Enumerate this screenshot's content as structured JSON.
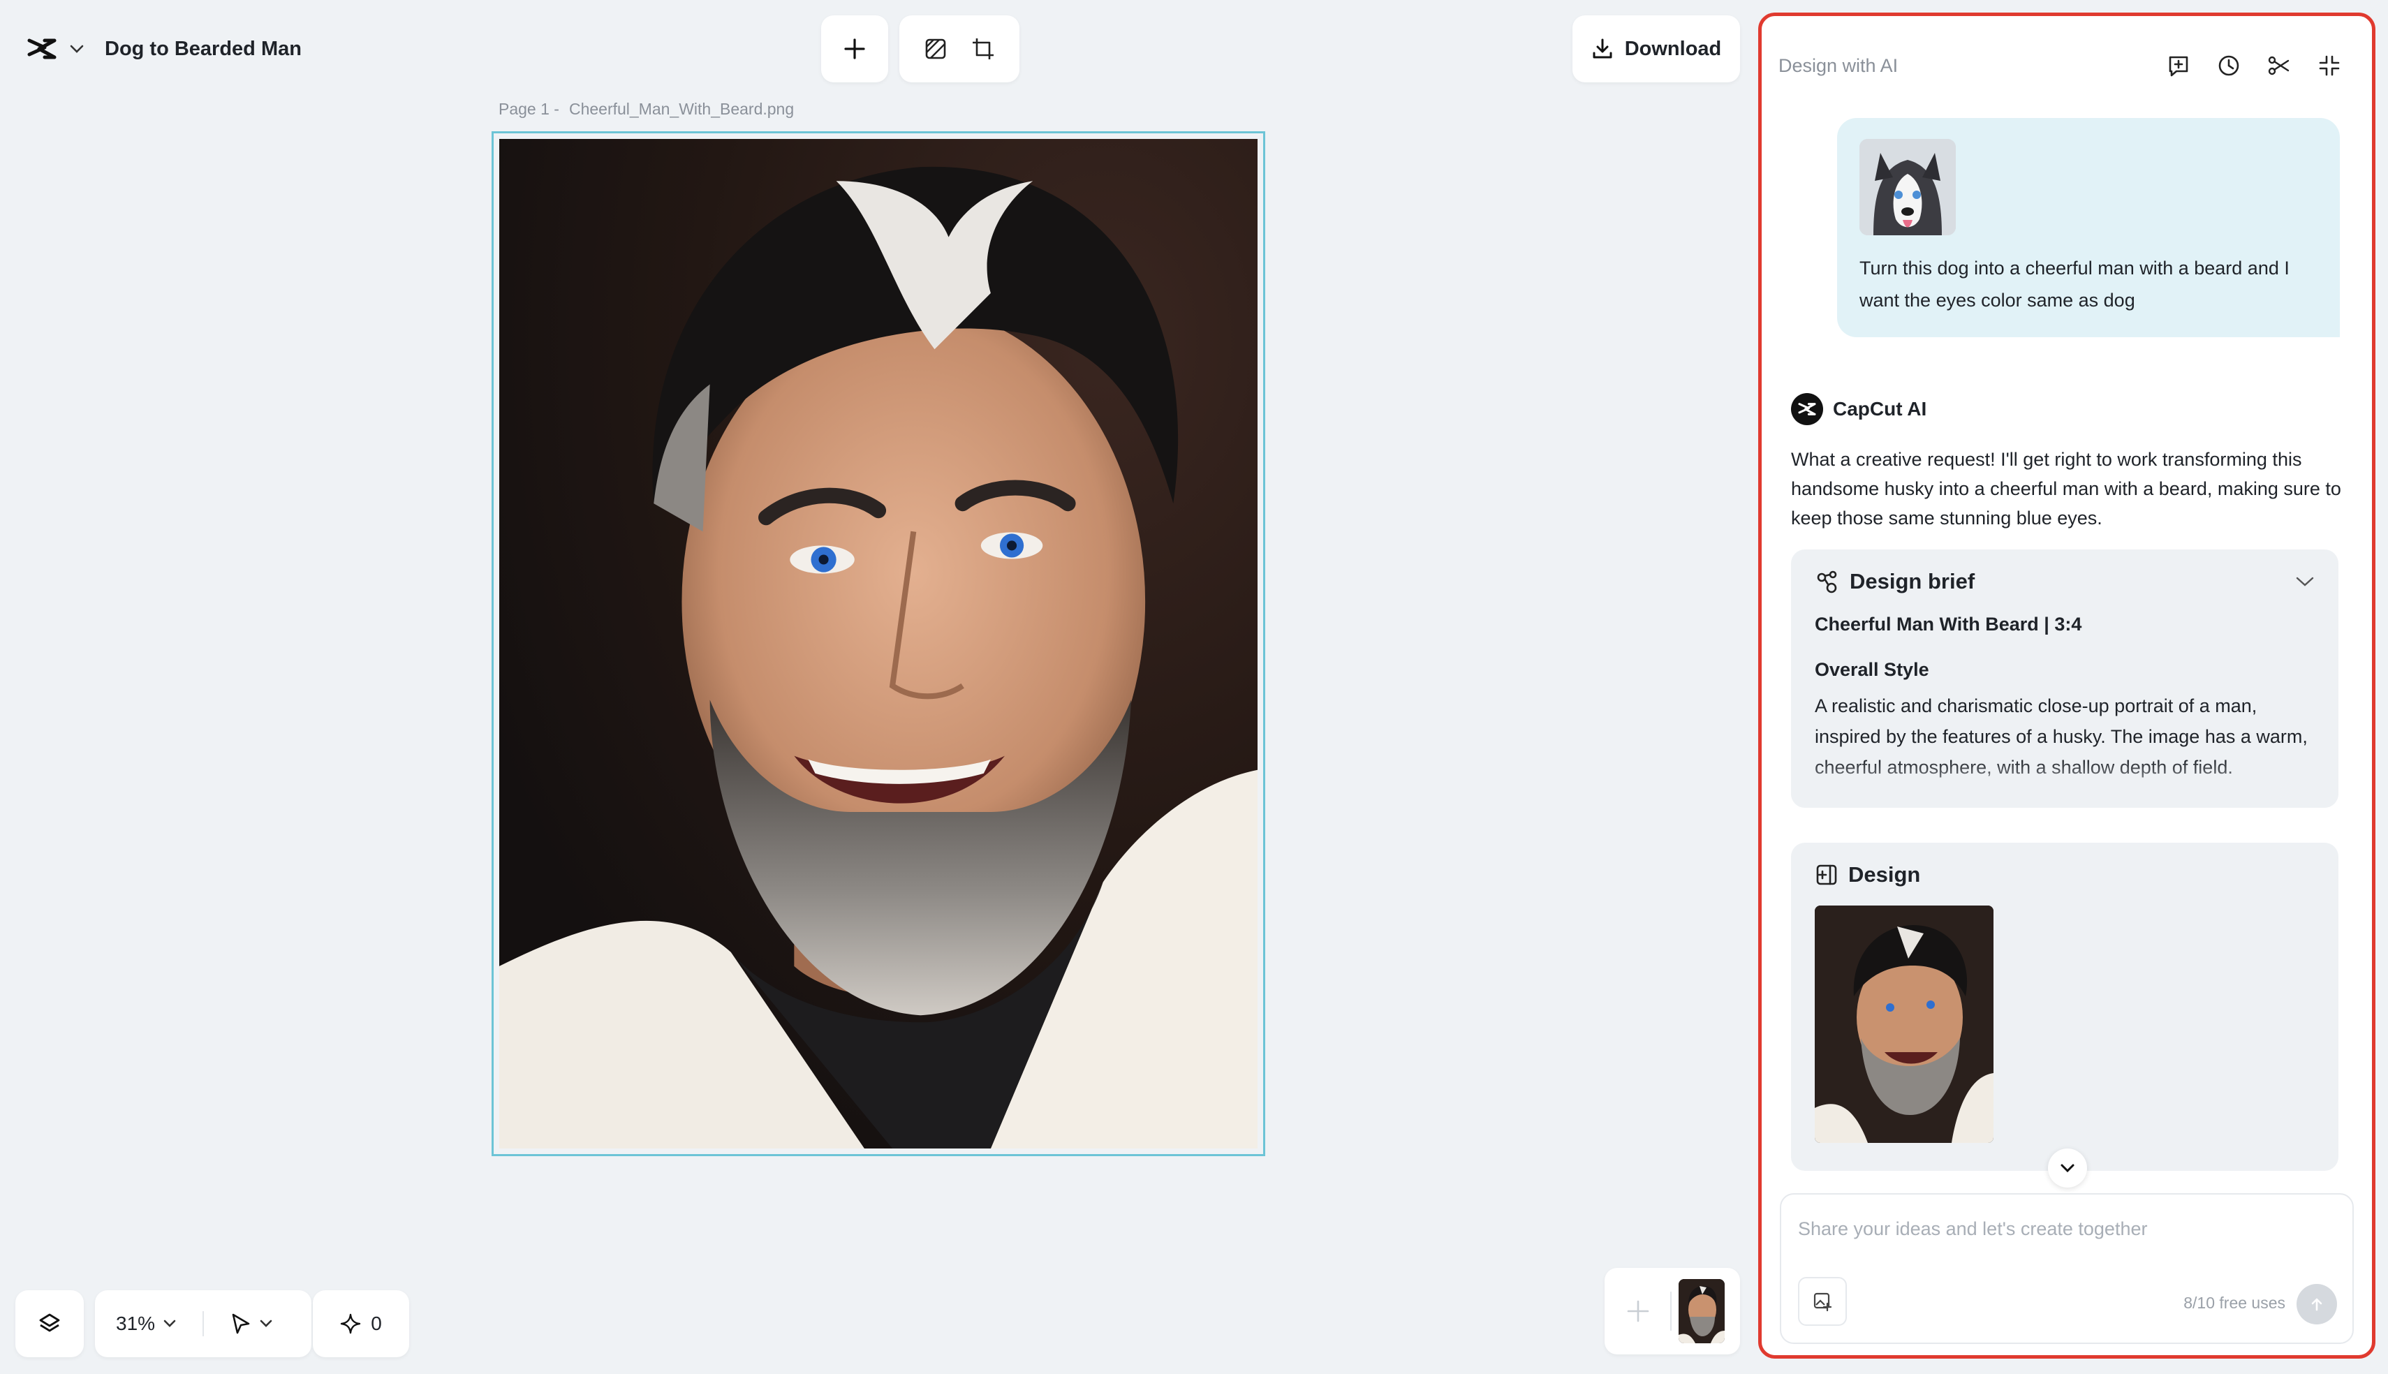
{
  "header": {
    "project_title": "Dog to Bearded Man",
    "download_label": "Download"
  },
  "canvas": {
    "page_label": "Page 1 -",
    "file_name": "Cheerful_Man_With_Beard.png"
  },
  "bottom_bar": {
    "zoom": "31%",
    "credits": "0"
  },
  "panel": {
    "title": "Design with AI",
    "user_message": "Turn this dog into a cheerful man with a beard and I want the eyes color same as dog",
    "ai_name": "CapCut AI",
    "ai_reply": "What a creative request! I'll get right to work transforming this handsome husky into a cheerful man with a beard, making sure to keep those same stunning blue eyes.",
    "brief": {
      "heading": "Design brief",
      "subtitle": "Cheerful Man With Beard | 3:4",
      "style_heading": "Overall Style",
      "style_text": "A realistic and charismatic close-up portrait of a man, inspired by the features of a husky. The image has a warm, cheerful atmosphere, with a shallow depth of field."
    },
    "design_heading": "Design",
    "composer": {
      "placeholder": "Share your ideas and let's create together",
      "free_uses": "8/10 free uses"
    }
  },
  "colors": {
    "accent_border": "#e03a2f",
    "frame_border": "#6cc4d6",
    "user_bubble": "#e1f2f7",
    "background": "#eff2f5"
  },
  "icons": [
    "capcut-logo-icon",
    "chevron-down-icon",
    "plus-icon",
    "background-remove-icon",
    "resize-icon",
    "download-icon",
    "layers-icon",
    "pointer-icon",
    "sparkle-icon",
    "new-chat-icon",
    "history-icon",
    "share-icon",
    "collapse-icon",
    "design-brief-icon",
    "design-icon",
    "image-upload-icon",
    "send-arrow-icon"
  ]
}
